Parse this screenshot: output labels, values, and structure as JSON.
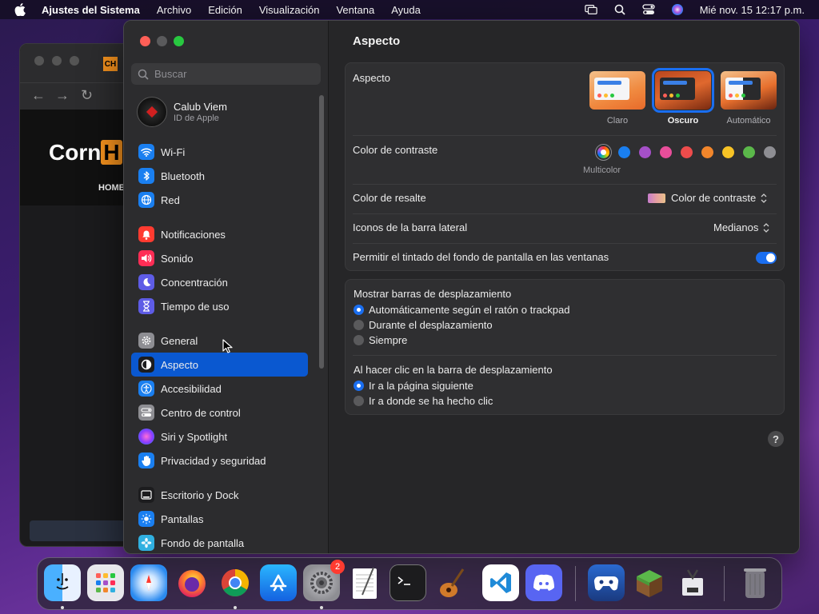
{
  "menubar": {
    "app_name": "Ajustes del Sistema",
    "items": [
      "Archivo",
      "Edición",
      "Visualización",
      "Ventana",
      "Ayuda"
    ],
    "clock": "Mié nov. 15  12:17 p.m."
  },
  "background_window": {
    "logo_text": "Corn",
    "logo_badge": "H",
    "tab_icon": "CH",
    "nav_label": "HOME"
  },
  "sidebar": {
    "search_placeholder": "Buscar",
    "account": {
      "name": "Calub Viem",
      "subtitle": "ID de Apple"
    },
    "items": [
      {
        "label": "Wi-Fi",
        "icon": "wifi-icon",
        "color": "#1a7ff0"
      },
      {
        "label": "Bluetooth",
        "icon": "bluetooth-icon",
        "color": "#1a7ff0"
      },
      {
        "label": "Red",
        "icon": "globe-icon",
        "color": "#1a7ff0"
      },
      {
        "label": "Notificaciones",
        "icon": "bell-icon",
        "color": "#ff3b30"
      },
      {
        "label": "Sonido",
        "icon": "speaker-icon",
        "color": "#ff2d55"
      },
      {
        "label": "Concentración",
        "icon": "moon-icon",
        "color": "#5e5ce6"
      },
      {
        "label": "Tiempo de uso",
        "icon": "hourglass-icon",
        "color": "#5e5ce6"
      },
      {
        "label": "General",
        "icon": "gear-icon",
        "color": "#8e8e93"
      },
      {
        "label": "Aspecto",
        "icon": "appearance-icon",
        "color": "#1c1c1e"
      },
      {
        "label": "Accesibilidad",
        "icon": "accessibility-icon",
        "color": "#1a7ff0"
      },
      {
        "label": "Centro de control",
        "icon": "control-center-icon",
        "color": "#8e8e93"
      },
      {
        "label": "Siri y Spotlight",
        "icon": "siri-icon",
        "color": "#b040e0"
      },
      {
        "label": "Privacidad y seguridad",
        "icon": "hand-icon",
        "color": "#1a7ff0"
      },
      {
        "label": "Escritorio y Dock",
        "icon": "dock-icon",
        "color": "#1c1c1e"
      },
      {
        "label": "Pantallas",
        "icon": "sun-icon",
        "color": "#1a7ff0"
      },
      {
        "label": "Fondo de pantalla",
        "icon": "flower-icon",
        "color": "#30b0e0"
      }
    ],
    "active_label": "Aspecto"
  },
  "main": {
    "title": "Aspecto",
    "appearance": {
      "label": "Aspecto",
      "options": [
        "Claro",
        "Oscuro",
        "Automático"
      ],
      "selected": "Oscuro"
    },
    "accent": {
      "label": "Color de contraste",
      "selected_name": "Multicolor",
      "colors": [
        "multicolor",
        "#1a7ff0",
        "#a550c8",
        "#e84e9a",
        "#ee4c4c",
        "#f2862b",
        "#f7c325",
        "#5bb84a",
        "#8e8e93"
      ]
    },
    "highlight": {
      "label": "Color de resalte",
      "value": "Color de contraste"
    },
    "sidebar_icons": {
      "label": "Iconos de la barra lateral",
      "value": "Medianos"
    },
    "tinting": {
      "label": "Permitir el tintado del fondo de pantalla en las ventanas",
      "enabled": true
    },
    "scrollbars": {
      "title": "Mostrar barras de desplazamiento",
      "options": [
        "Automáticamente según el ratón o trackpad",
        "Durante el desplazamiento",
        "Siempre"
      ],
      "selected_index": 0
    },
    "click_scrollbar": {
      "title": "Al hacer clic en la barra de desplazamiento",
      "options": [
        "Ir a la página siguiente",
        "Ir a donde se ha hecho clic"
      ],
      "selected_index": 0
    },
    "help_label": "?"
  },
  "dock": {
    "apps": [
      {
        "name": "finder-icon",
        "running": true
      },
      {
        "name": "launchpad-icon",
        "running": false
      },
      {
        "name": "safari-icon",
        "running": false
      },
      {
        "name": "firefox-icon",
        "running": false
      },
      {
        "name": "chrome-icon",
        "running": true
      },
      {
        "name": "app-store-icon",
        "running": false
      },
      {
        "name": "system-settings-icon",
        "running": true,
        "badge": "2"
      },
      {
        "name": "textedit-icon",
        "running": false
      },
      {
        "name": "terminal-icon",
        "running": false
      },
      {
        "name": "garageband-icon",
        "running": false
      },
      {
        "name": "vscode-icon",
        "running": false
      },
      {
        "name": "discord-icon",
        "running": false
      },
      {
        "name": "game-controller-icon",
        "running": false
      },
      {
        "name": "minecraft-icon",
        "running": false
      },
      {
        "name": "installer-icon",
        "running": false
      },
      {
        "name": "trash-icon",
        "running": false
      }
    ]
  }
}
